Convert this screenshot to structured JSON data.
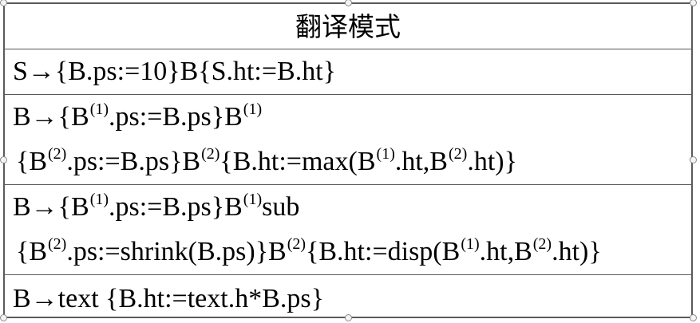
{
  "table": {
    "header": "翻译模式",
    "rows": [
      {
        "lines": [
          [
            {
              "t": "S→{B.ps:=10}B{S.ht:=B.ht}"
            }
          ]
        ]
      },
      {
        "lines": [
          [
            {
              "t": "B→{B"
            },
            {
              "sup": "(1)"
            },
            {
              "t": ".ps:=B.ps}B"
            },
            {
              "sup": "(1)"
            }
          ],
          [
            {
              "t": "{B"
            },
            {
              "sup": "(2)"
            },
            {
              "t": ".ps:=B.ps}B"
            },
            {
              "sup": "(2)"
            },
            {
              "t": "{B.ht:=max(B"
            },
            {
              "sup": "(1)"
            },
            {
              "t": ".ht,B"
            },
            {
              "sup": "(2)"
            },
            {
              "t": ".ht)}"
            }
          ]
        ]
      },
      {
        "lines": [
          [
            {
              "t": "B→{B"
            },
            {
              "sup": "(1)"
            },
            {
              "t": ".ps:=B.ps}B"
            },
            {
              "sup": "(1)"
            },
            {
              "t": "sub"
            }
          ],
          [
            {
              "t": "{B"
            },
            {
              "sup": "(2)"
            },
            {
              "t": ".ps:=shrink(B.ps)}B"
            },
            {
              "sup": "(2)"
            },
            {
              "t": "{B.ht:=disp(B"
            },
            {
              "sup": "(1)"
            },
            {
              "t": ".ht,B"
            },
            {
              "sup": "(2)"
            },
            {
              "t": ".ht)}"
            }
          ]
        ]
      },
      {
        "lines": [
          [
            {
              "t": "B→text {B.ht:=text.h*B.ps}"
            }
          ]
        ]
      }
    ]
  },
  "colors": {
    "border": "#5a5a5a",
    "text": "#000000",
    "background": "#ffffff",
    "handle": "#f4f4f4"
  }
}
